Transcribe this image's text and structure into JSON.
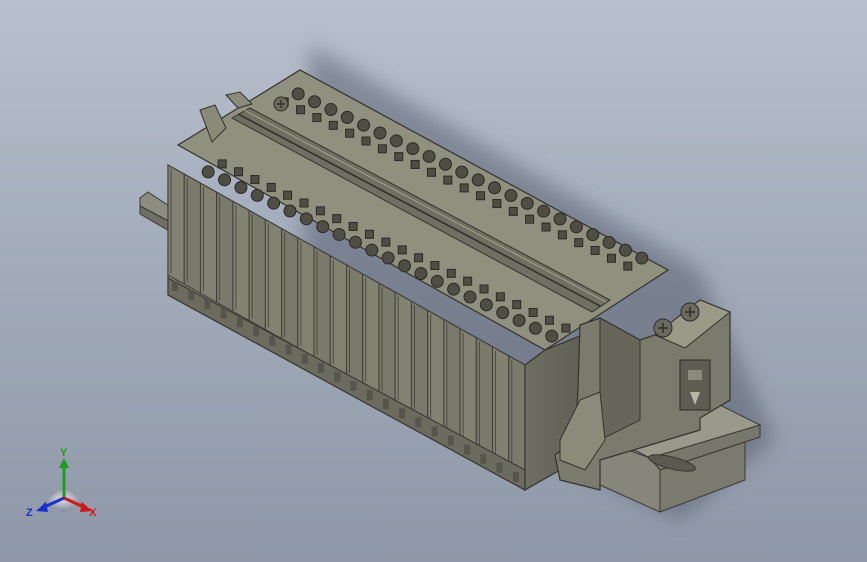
{
  "viewport": {
    "background_top": "#b9c0cd",
    "background_bottom": "#8f98a8",
    "model_color": "#7c7c6e",
    "model_dark": "#4f4f45",
    "model_light": "#a2a290",
    "rail_color": "#86867a"
  },
  "model": {
    "terminal_count": 22
  },
  "triad": {
    "x_label": "X",
    "y_label": "Y",
    "z_label": "Z",
    "x_color": "#d01818",
    "y_color": "#18a018",
    "z_color": "#1830d0"
  }
}
